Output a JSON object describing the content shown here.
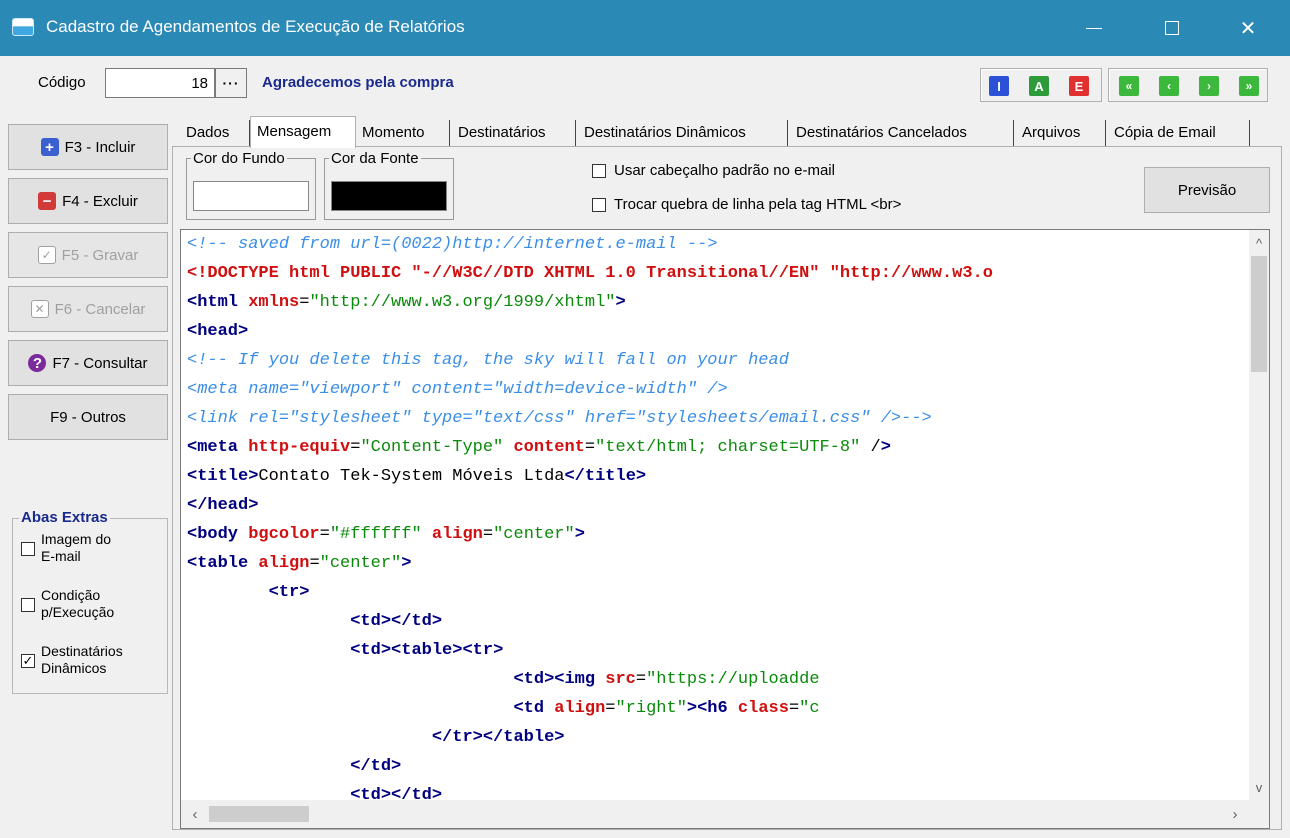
{
  "window": {
    "title": "Cadastro de Agendamentos de Execução de Relatórios",
    "minimize": "—",
    "maximize": "☐",
    "close": "✕"
  },
  "header": {
    "code_label": "Código",
    "code_value": "18",
    "code_more": "···",
    "description": "Agradecemos pela compra",
    "record_buttons": [
      "I",
      "A",
      "E"
    ],
    "nav_buttons": [
      "«",
      "‹",
      "›",
      "»"
    ]
  },
  "sidebar": {
    "buttons": [
      {
        "label": "F3 - Incluir",
        "icon": "plus-icon",
        "disabled": false
      },
      {
        "label": "F4 - Excluir",
        "icon": "minus-icon",
        "disabled": false
      },
      {
        "label": "F5 - Gravar",
        "icon": "check-icon",
        "disabled": true
      },
      {
        "label": "F6 - Cancelar",
        "icon": "x-icon",
        "disabled": true
      },
      {
        "label": "F7 - Consultar",
        "icon": "question-icon",
        "disabled": false
      },
      {
        "label": "F9 - Outros",
        "icon": "",
        "disabled": false
      }
    ],
    "extras": {
      "legend": "Abas Extras",
      "items": [
        {
          "label1": "Imagem do",
          "label2": "E-mail",
          "checked": false
        },
        {
          "label1": "Condição",
          "label2": "p/Execução",
          "checked": false
        },
        {
          "label1": "Destinatários",
          "label2": "Dinâmicos",
          "checked": true
        }
      ]
    }
  },
  "tabs": [
    "Dados",
    "Mensagem",
    "Momento",
    "Destinatários",
    "Destinatários Dinâmicos",
    "Destinatários Cancelados",
    "Arquivos",
    "Cópia de Email"
  ],
  "active_tab": "Mensagem",
  "message": {
    "bg_color_label": "Cor do Fundo",
    "bg_color": "#ffffff",
    "font_color_label": "Cor da Fonte",
    "font_color": "#000000",
    "opt_header": "Usar cabeçalho padrão no e-mail",
    "opt_br": "Trocar quebra de linha pela tag HTML <br>",
    "preview": "Previsão"
  },
  "code_lines": [
    "<!-- saved from url=(0022)http://internet.e-mail -->",
    "<!DOCTYPE html PUBLIC \"-//W3C//DTD XHTML 1.0 Transitional//EN\" \"http://www.w3.o",
    "<html xmlns=\"http://www.w3.org/1999/xhtml\">",
    "<head>",
    "<!-- If you delete this tag, the sky will fall on your head",
    "<meta name=\"viewport\" content=\"width=device-width\" />",
    "<link rel=\"stylesheet\" type=\"text/css\" href=\"stylesheets/email.css\" />-->",
    "<meta http-equiv=\"Content-Type\" content=\"text/html; charset=UTF-8\" />",
    "<title>Contato Tek-System Móveis Ltda</title>",
    "</head>",
    "<body bgcolor=\"#ffffff\" align=\"center\">",
    "<table align=\"center\">",
    "        <tr>",
    "                <td></td>",
    "                <td><table><tr>",
    "                                <td><img src=\"https://uploadde",
    "                                <td align=\"right\"><h6 class=\"c",
    "                        </tr></table>",
    "                </td>",
    "                <td></td>"
  ]
}
